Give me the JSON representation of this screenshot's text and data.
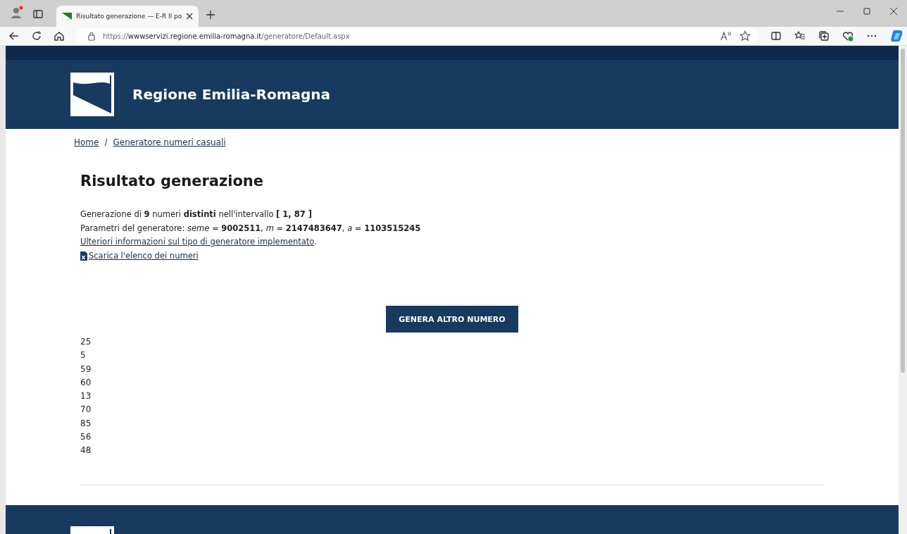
{
  "browser": {
    "tab": {
      "title": "Risultato generazione — E-R Il po",
      "selected": true
    },
    "url": {
      "scheme": "https://",
      "host": "wwwservizi.regione.emilia-romagna.it",
      "path": "/generatore/Default.aspx"
    }
  },
  "header": {
    "site_name": "Regione Emilia-Romagna"
  },
  "breadcrumb": [
    {
      "label": "Home"
    },
    {
      "label": "Generatore numeri casuali"
    }
  ],
  "breadcrumb_separator": "/",
  "heading": "Risultato generazione",
  "info_lines": [
    "Generazione di **9** numeri **distinti** nell'intervallo **[ 1, 87 ]**",
    "Parametri del generatore: *seme* = **9002511**, *m* = **2147483647**, *a* = **1103515245**"
  ],
  "info_link": {
    "label": "Ulteriori informazioni sul tipo di generatore implementato",
    "after": "."
  },
  "download_link": {
    "label": "Scarica l'elenco dei numeri"
  },
  "generate_button": {
    "label": "GENERA ALTRO NUMERO"
  },
  "numbers": [
    "25",
    "5",
    "59",
    "60",
    "13",
    "70",
    "85",
    "56",
    "48"
  ]
}
